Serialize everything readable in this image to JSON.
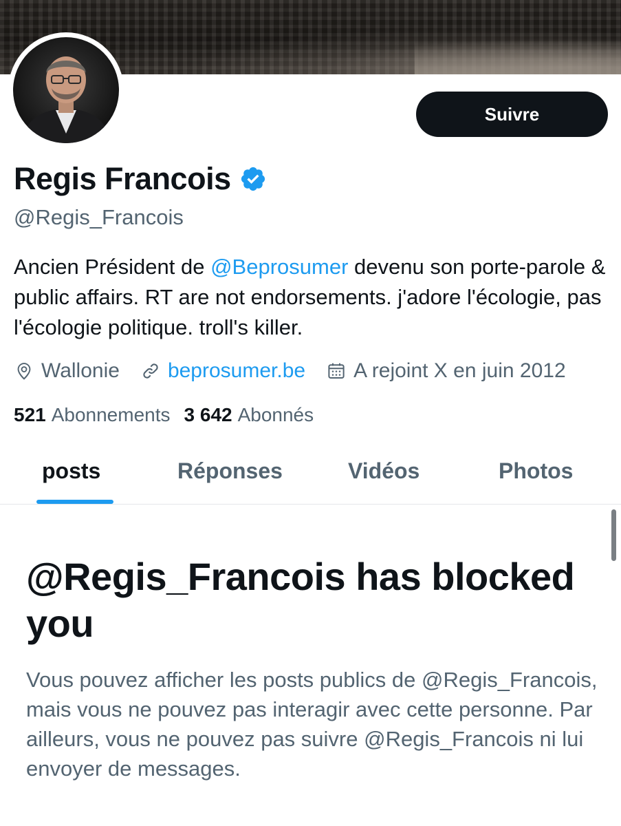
{
  "profile": {
    "display_name": "Regis Francois",
    "handle": "@Regis_Francois",
    "verified": true,
    "follow_label": "Suivre",
    "bio": {
      "part1": "Ancien Président de ",
      "mention": "@Beprosumer",
      "part2": " devenu son porte-parole & public affairs. RT are not endorsements. j'adore l'écologie, pas l'écologie politique. troll's killer."
    },
    "location": "Wallonie",
    "website": "beprosumer.be",
    "joined": "A rejoint X en juin 2012",
    "following_count": "521",
    "following_label": "Abonnements",
    "followers_count": "3 642",
    "followers_label": "Abonnés"
  },
  "tabs": [
    {
      "label": "posts",
      "active": true
    },
    {
      "label": "Réponses",
      "active": false
    },
    {
      "label": "Vidéos",
      "active": false
    },
    {
      "label": "Photos",
      "active": false
    }
  ],
  "blocked": {
    "title": "@Regis_Francois has blocked you",
    "description": "Vous pouvez afficher les posts publics de @Regis_Francois, mais vous ne pouvez pas interagir avec cette personne. Par ailleurs, vous ne pouvez pas suivre @Regis_Francois ni lui envoyer de messages."
  },
  "colors": {
    "accent": "#1d9bf0",
    "text_primary": "#0f1419",
    "text_secondary": "#536471",
    "button_bg": "#0f1419"
  },
  "icons": {
    "verified": "verified-badge-icon",
    "location": "location-pin-icon",
    "link": "link-icon",
    "calendar": "calendar-icon"
  }
}
